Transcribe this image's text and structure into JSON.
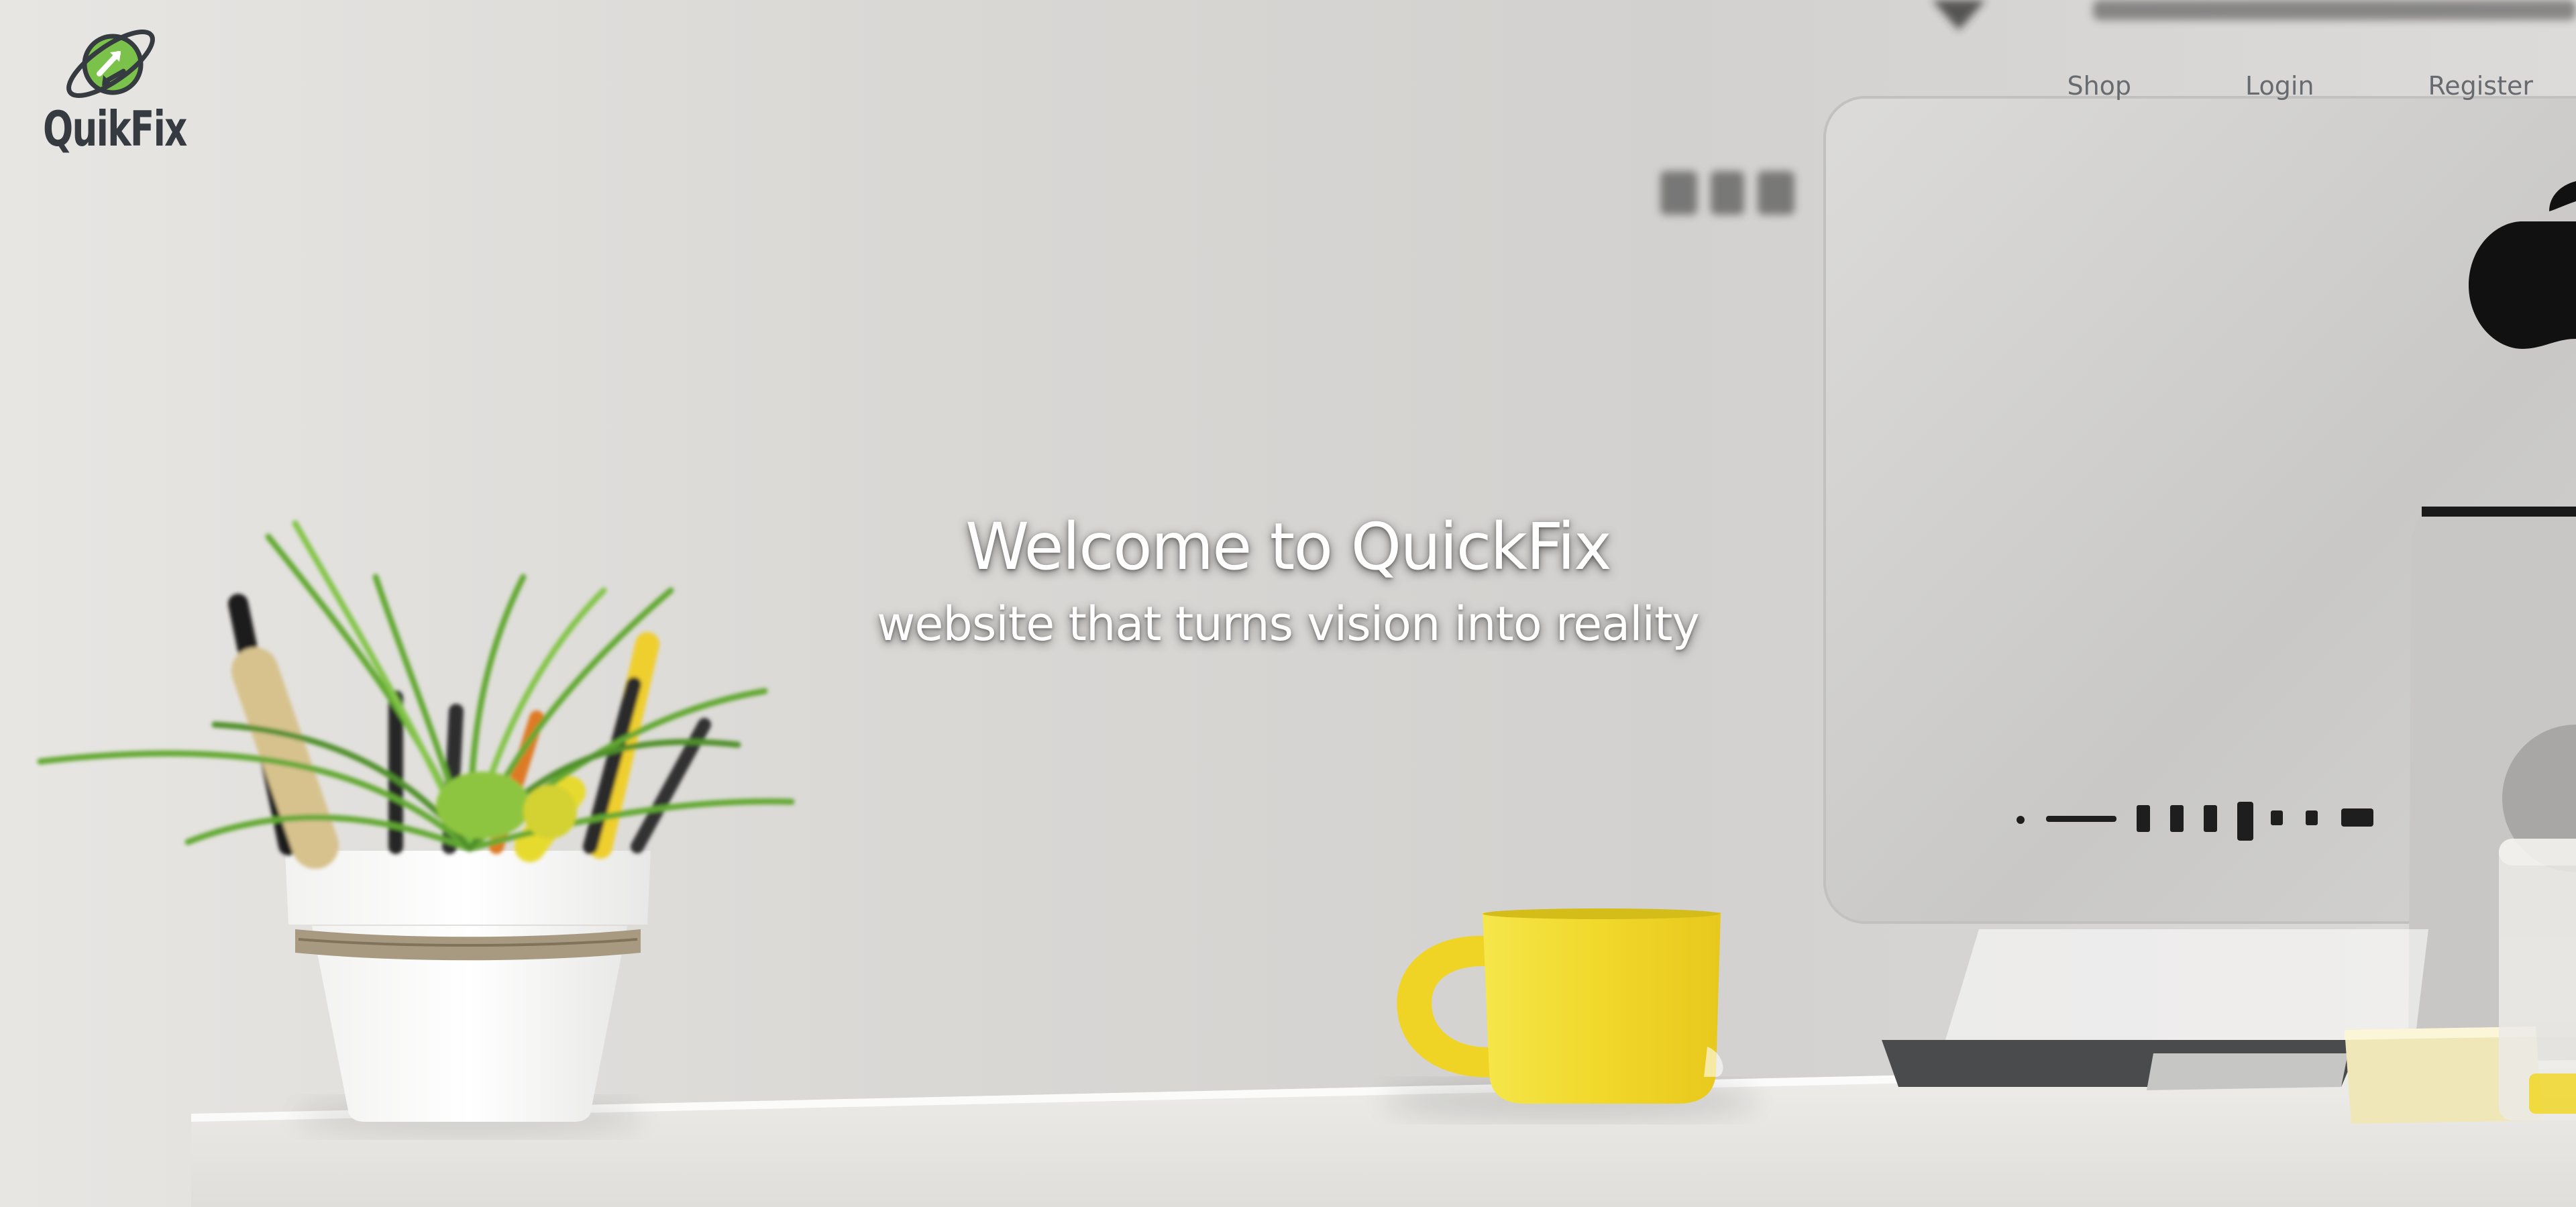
{
  "brand": {
    "name": "QuikFix",
    "logo_icon": "planet-arrows-icon",
    "logo_ring_color": "#353b40",
    "logo_fill_color": "#7bc24a"
  },
  "nav": {
    "items": [
      {
        "label": "Shop"
      },
      {
        "label": "Login"
      },
      {
        "label": "Register"
      }
    ]
  },
  "hero": {
    "title": "Welcome to QuickFix",
    "subtitle": "website that turns vision into reality",
    "background_image": "desk-workspace-photo",
    "background_scene": [
      "potted-plant-with-pencils",
      "yellow-mug",
      "desktop-monitor",
      "white-desk"
    ]
  },
  "colors": {
    "text_on_hero": "#ffffff",
    "nav_text": "#676b6f",
    "mug_yellow": "#f2dc2e",
    "plant_green": "#62a830"
  }
}
